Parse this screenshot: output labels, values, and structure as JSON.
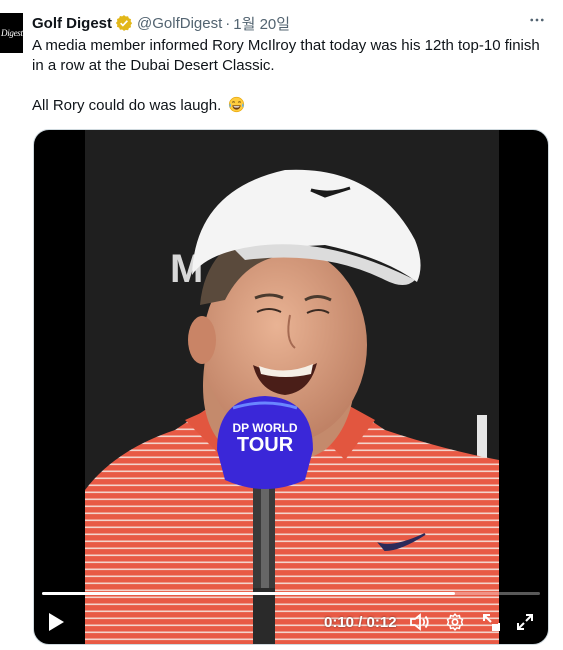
{
  "tweet": {
    "author_name": "Golf Digest",
    "handle": "@GolfDigest",
    "separator": "·",
    "date": "1월 20일",
    "avatar_text": "Digest",
    "text": "A media member informed Rory McIlroy that today was his 12th top-10 finish in a row at the Dubai Desert Classic.\n\nAll Rory could do was laugh. ",
    "emoji": "face-with-tears-of-joy"
  },
  "video": {
    "current_time": "0:10",
    "time_separator": " / ",
    "duration": "0:12",
    "progress": 0.83,
    "backdrop_text": "M",
    "mic_brand_line1": "DP WORLD",
    "mic_brand_line2": "TOUR",
    "colors": {
      "shirt": "#e85a45",
      "shirt_stripe": "#f3d4cc",
      "cap": "#f4f4f4",
      "mic_head": "#3a27d8",
      "backdrop": "#1c1c1c"
    }
  },
  "icons": {
    "verified": "verified-gold-badge-icon",
    "more": "more-options-icon",
    "play": "play-icon",
    "volume": "volume-icon",
    "settings": "settings-gear-icon",
    "pip": "picture-in-picture-icon",
    "fullscreen": "fullscreen-icon"
  }
}
